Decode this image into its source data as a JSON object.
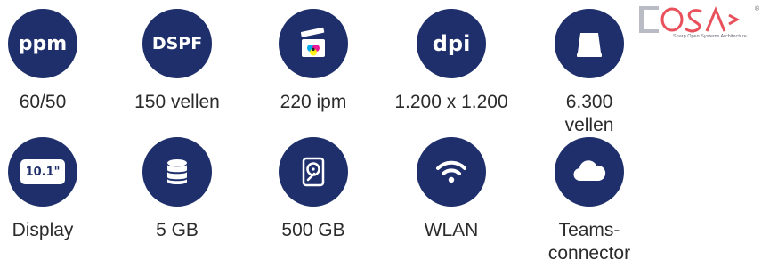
{
  "features": [
    {
      "id": "ppm",
      "icon": "ppm-badge-icon",
      "icon_text": "ppm",
      "label": "60/50"
    },
    {
      "id": "dspf",
      "icon": "dspf-badge-icon",
      "icon_text": "DSPF",
      "label": "150 vellen"
    },
    {
      "id": "ipm",
      "icon": "scan-clapper-icon",
      "label": "220 ipm"
    },
    {
      "id": "dpi",
      "icon": "dpi-badge-icon",
      "icon_text": "dpi",
      "label": "1.200 x 1.200"
    },
    {
      "id": "paper",
      "icon": "paper-tray-icon",
      "label": "6.300 vellen"
    },
    {
      "id": "display",
      "icon": "display-icon",
      "icon_text": "10.1\"",
      "label": "Display"
    },
    {
      "id": "storage",
      "icon": "database-icon",
      "label": "5 GB"
    },
    {
      "id": "hdd",
      "icon": "hard-disk-icon",
      "label": "500 GB"
    },
    {
      "id": "wlan",
      "icon": "wifi-icon",
      "label": "WLAN"
    },
    {
      "id": "teams",
      "icon": "cloud-icon",
      "label": "Teams-connector"
    }
  ],
  "logo": {
    "name": "OSA",
    "tagline": "Sharp Open Systems Architecture",
    "registered": "®"
  },
  "colors": {
    "circle": "#1e2f6b",
    "text": "#2b2b2b",
    "logo_red": "#e8505b",
    "logo_grey": "#b9bcc4"
  }
}
